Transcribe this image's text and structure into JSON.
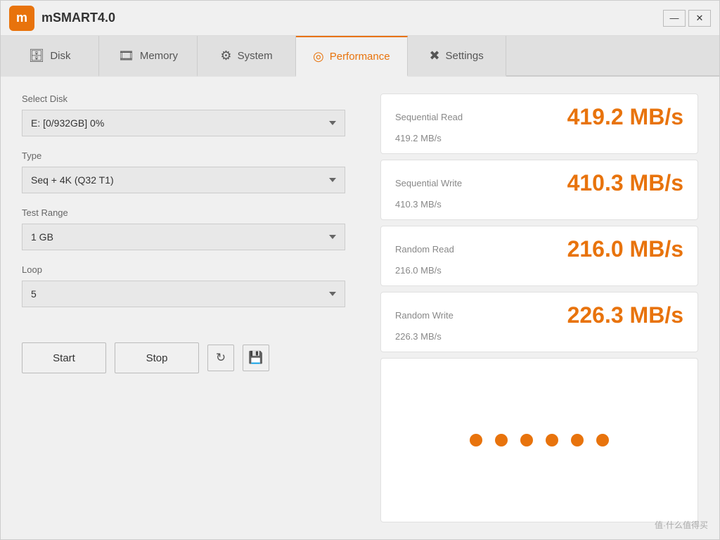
{
  "app": {
    "logo_text": "m",
    "title": "mSMART4.0"
  },
  "window_controls": {
    "minimize": "—",
    "close": "✕"
  },
  "tabs": [
    {
      "id": "disk",
      "label": "Disk",
      "icon": "🗄"
    },
    {
      "id": "memory",
      "label": "Memory",
      "icon": "🎞"
    },
    {
      "id": "system",
      "label": "System",
      "icon": "⚙"
    },
    {
      "id": "performance",
      "label": "Performance",
      "icon": "◎",
      "active": true
    },
    {
      "id": "settings",
      "label": "Settings",
      "icon": "✖"
    }
  ],
  "left_panel": {
    "select_disk_label": "Select Disk",
    "select_disk_value": "E: [0/932GB] 0%",
    "type_label": "Type",
    "type_value": "Seq + 4K (Q32 T1)",
    "test_range_label": "Test Range",
    "test_range_value": "1 GB",
    "loop_label": "Loop",
    "loop_value": "5"
  },
  "buttons": {
    "start_label": "Start",
    "stop_label": "Stop"
  },
  "metrics": [
    {
      "label": "Sequential Read",
      "value_large": "419.2 MB/s",
      "value_small": "419.2 MB/s"
    },
    {
      "label": "Sequential Write",
      "value_large": "410.3 MB/s",
      "value_small": "410.3 MB/s"
    },
    {
      "label": "Random Read",
      "value_large": "216.0 MB/s",
      "value_small": "216.0 MB/s"
    },
    {
      "label": "Random Write",
      "value_large": "226.3 MB/s",
      "value_small": "226.3 MB/s"
    }
  ],
  "dots": [
    "dot1",
    "dot2",
    "dot3",
    "dot4",
    "dot5",
    "dot6"
  ],
  "watermark": "值·什么值得买"
}
